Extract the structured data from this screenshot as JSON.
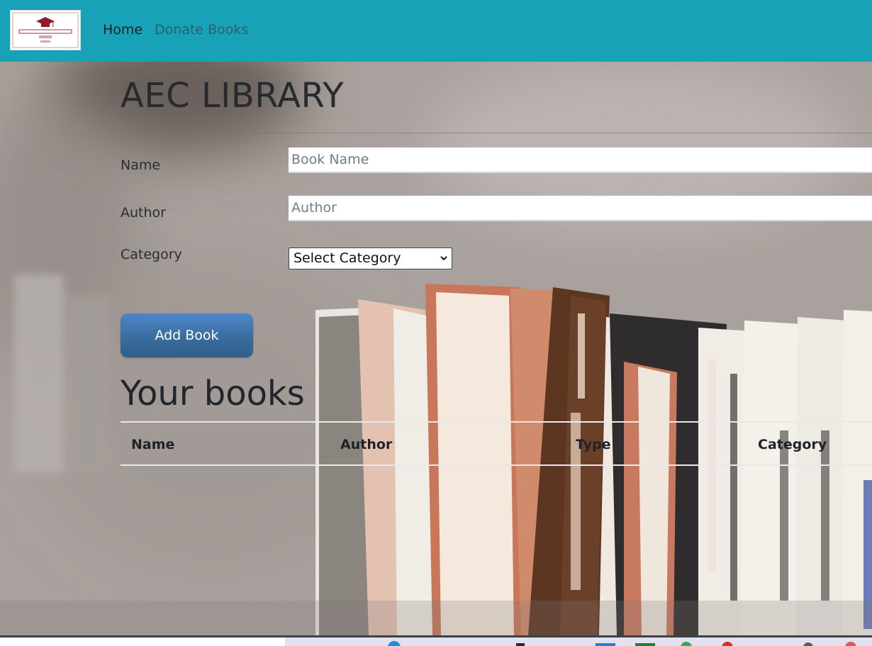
{
  "navbar": {
    "logo_text": "ALAGAPPA ENGINEERING COLLEGE",
    "links": [
      {
        "label": "Home"
      },
      {
        "label": "Donate Books"
      }
    ]
  },
  "main": {
    "title": "AEC LIBRARY",
    "form": {
      "name_label": "Name",
      "name_placeholder": "Book Name",
      "author_label": "Author",
      "author_placeholder": "Author",
      "category_label": "Category",
      "category_selected": "Select Category",
      "submit_label": "Add Book"
    },
    "books_section": {
      "title": "Your books",
      "columns": [
        "Name",
        "Author",
        "Type",
        "Category"
      ],
      "rows": []
    }
  },
  "colors": {
    "navbar": "#17a2b8",
    "button": "#3a6d9f"
  },
  "icons": {
    "select_arrow": "chevron-down-icon",
    "logo": "graduation-cap-icon"
  }
}
